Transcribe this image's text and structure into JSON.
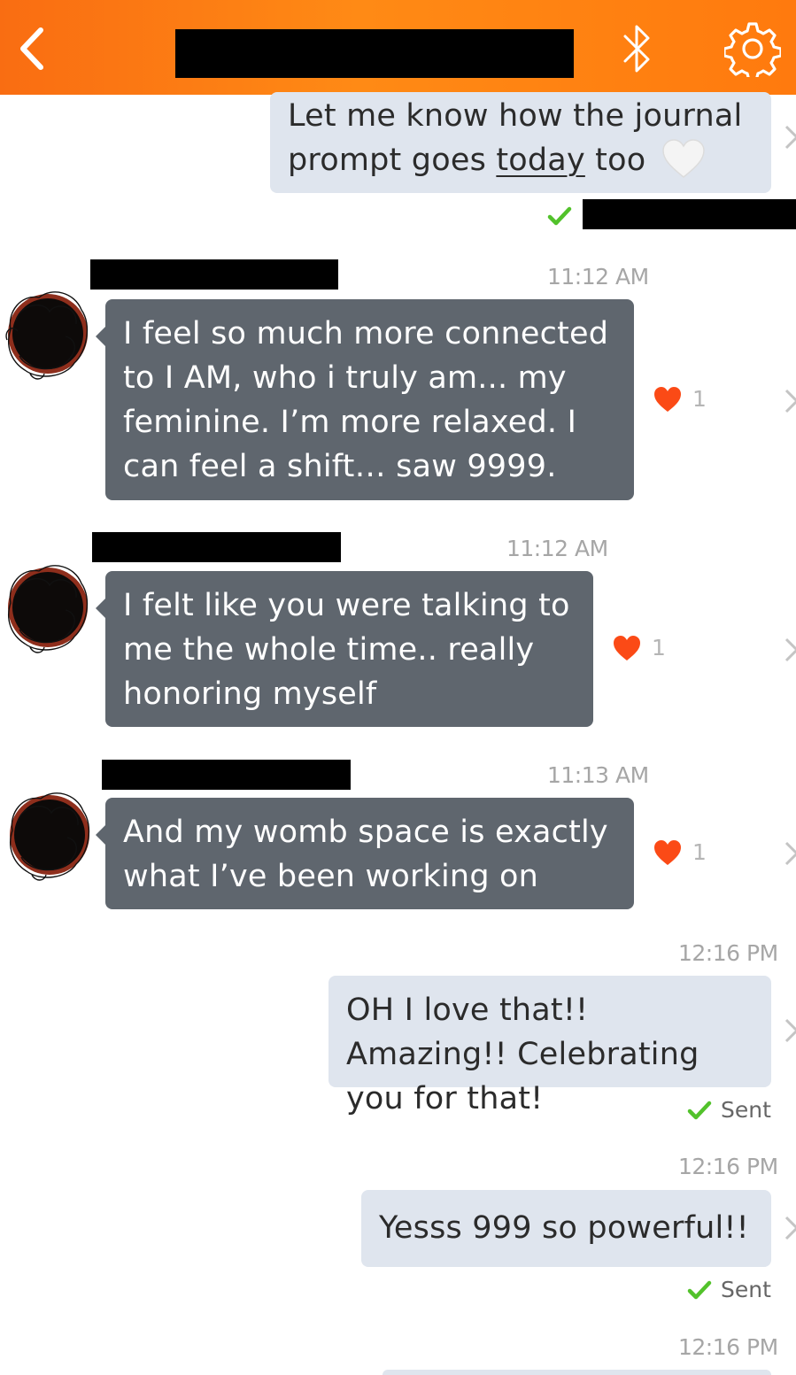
{
  "header": {
    "back_icon": "chevron-left-icon",
    "bluetooth_icon": "bluetooth-icon",
    "settings_icon": "gear-icon",
    "colors": {
      "bar": "#ff7a0e",
      "icon": "#ffffff"
    }
  },
  "messages": {
    "m1": {
      "line1": "Let me know how the journal",
      "line2_pre": "prompt goes ",
      "line2_u": "today",
      "line2_post": " too",
      "emoji": "white-heart-icon"
    },
    "m2": {
      "time": "11:12 AM",
      "text": "I feel so much more connected to I AM, who i truly am... my feminine. I’m more relaxed. I can feel a shift… saw 9999.",
      "likes": "1"
    },
    "m3": {
      "time": "11:12 AM",
      "text": "I felt like you were talking to me the whole time.. really honoring myself",
      "likes": "1"
    },
    "m4": {
      "time": "11:13 AM",
      "text": "And my womb space is exactly what I’ve been working on",
      "likes": "1"
    },
    "m5": {
      "time": "12:16 PM",
      "text": "OH I love that!! Amazing!! Celebrating you for that!",
      "status": "Sent"
    },
    "m6": {
      "time": "12:16 PM",
      "text": "Yesss 999 so powerful!!",
      "status": "Sent"
    },
    "m7": {
      "time": "12:16 PM"
    }
  },
  "colors": {
    "outgoing_bubble": "#dfe5ee",
    "incoming_bubble": "#5f666e",
    "heart": "#fb4a16",
    "check": "#52c22b"
  }
}
